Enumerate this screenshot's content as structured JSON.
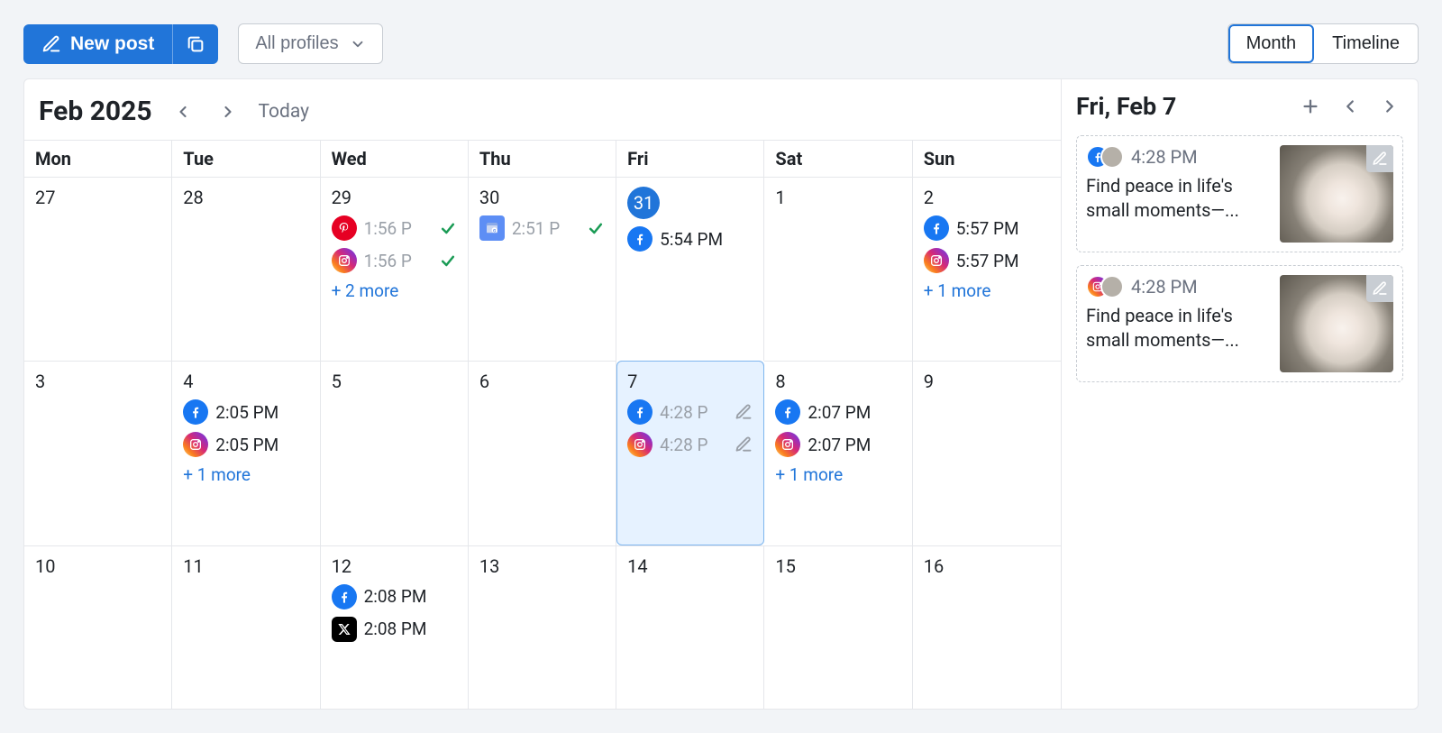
{
  "toolbar": {
    "new_post": "New post",
    "profiles": "All profiles",
    "views": {
      "month": "Month",
      "timeline": "Timeline"
    }
  },
  "calendar": {
    "title": "Feb 2025",
    "today_label": "Today",
    "dow": [
      "Mon",
      "Tue",
      "Wed",
      "Thu",
      "Fri",
      "Sat",
      "Sun"
    ],
    "days": [
      {
        "num": "27",
        "events": []
      },
      {
        "num": "28",
        "events": []
      },
      {
        "num": "29",
        "events": [
          {
            "platform": "pinterest",
            "time": "1:56 P",
            "gray": true,
            "check": true
          },
          {
            "platform": "instagram",
            "time": "1:56 P",
            "gray": true,
            "check": true
          }
        ],
        "more": "+ 2 more"
      },
      {
        "num": "30",
        "events": [
          {
            "platform": "gbp",
            "time": "2:51 P",
            "gray": true,
            "check": true
          }
        ]
      },
      {
        "num": "31",
        "highlight": true,
        "events": [
          {
            "platform": "facebook",
            "time": "5:54 PM"
          }
        ]
      },
      {
        "num": "1",
        "events": []
      },
      {
        "num": "2",
        "events": [
          {
            "platform": "facebook",
            "time": "5:57 PM"
          },
          {
            "platform": "instagram",
            "time": "5:57 PM"
          }
        ],
        "more": "+ 1 more"
      },
      {
        "num": "3",
        "events": []
      },
      {
        "num": "4",
        "events": [
          {
            "platform": "facebook",
            "time": "2:05 PM"
          },
          {
            "platform": "instagram",
            "time": "2:05 PM"
          }
        ],
        "more": "+ 1 more"
      },
      {
        "num": "5",
        "events": []
      },
      {
        "num": "6",
        "events": []
      },
      {
        "num": "7",
        "selected": true,
        "events": [
          {
            "platform": "facebook",
            "time": "4:28 P",
            "gray": true,
            "edit": true
          },
          {
            "platform": "instagram",
            "time": "4:28 P",
            "gray": true,
            "edit": true
          }
        ]
      },
      {
        "num": "8",
        "events": [
          {
            "platform": "facebook",
            "time": "2:07 PM"
          },
          {
            "platform": "instagram",
            "time": "2:07 PM"
          }
        ],
        "more": "+ 1 more"
      },
      {
        "num": "9",
        "events": []
      },
      {
        "num": "10",
        "events": []
      },
      {
        "num": "11",
        "events": []
      },
      {
        "num": "12",
        "events": [
          {
            "platform": "facebook",
            "time": "2:08 PM"
          },
          {
            "platform": "x",
            "time": "2:08 PM"
          }
        ]
      },
      {
        "num": "13",
        "events": []
      },
      {
        "num": "14",
        "events": []
      },
      {
        "num": "15",
        "events": []
      },
      {
        "num": "16",
        "events": []
      }
    ]
  },
  "detail": {
    "title": "Fri, Feb 7",
    "posts": [
      {
        "platform": "facebook",
        "time": "4:28 PM",
        "text": "Find peace in life's small moments—..."
      },
      {
        "platform": "instagram",
        "time": "4:28 PM",
        "text": "Find peace in life's small moments—..."
      }
    ]
  }
}
